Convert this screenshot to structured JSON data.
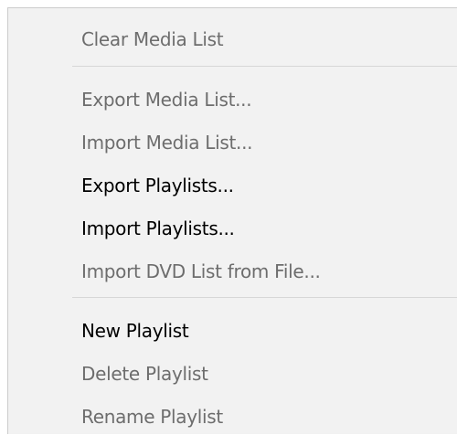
{
  "menu": {
    "items": [
      {
        "label": "Clear Media List",
        "enabled": false
      },
      {
        "label": "Export Media List...",
        "enabled": false
      },
      {
        "label": "Import Media List...",
        "enabled": false
      },
      {
        "label": "Export Playlists...",
        "enabled": true
      },
      {
        "label": "Import Playlists...",
        "enabled": true
      },
      {
        "label": "Import DVD List from File...",
        "enabled": false
      },
      {
        "label": "New Playlist",
        "enabled": true
      },
      {
        "label": "Delete Playlist",
        "enabled": false
      },
      {
        "label": "Rename Playlist",
        "enabled": false
      }
    ]
  }
}
